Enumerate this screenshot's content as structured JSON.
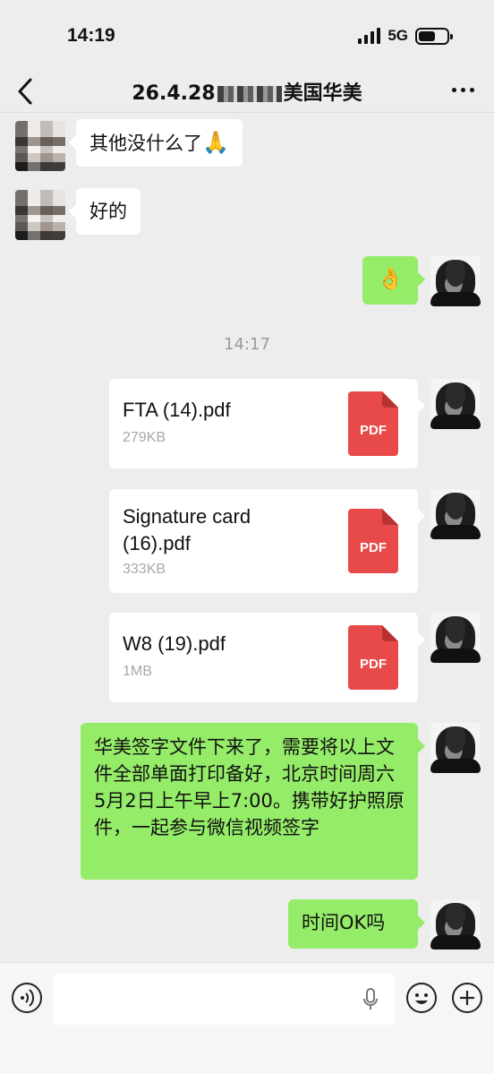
{
  "status_bar": {
    "time": "14:19",
    "network": "5G",
    "battery_level": 0.6
  },
  "header": {
    "title_prefix": "26.4.28",
    "title_suffix": "美国华美",
    "back_icon": "chevron-left-icon",
    "more_icon": "more-dots-icon"
  },
  "messages": [
    {
      "side": "left",
      "text": "其他没什么了",
      "emoji": "🙏"
    },
    {
      "side": "left",
      "text": "好的"
    },
    {
      "side": "right",
      "emoji": "👌"
    }
  ],
  "timestamp": "14:17",
  "files": [
    {
      "name": "FTA (14).pdf",
      "size": "279KB",
      "icon_label": "PDF"
    },
    {
      "name": "Signature card (16).pdf",
      "size": "333KB",
      "icon_label": "PDF"
    },
    {
      "name": "W8 (19).pdf",
      "size": "1MB",
      "icon_label": "PDF"
    }
  ],
  "long_message": "华美签字文件下来了，需要将以上文件全部单面打印备好，北京时间周六5月2日上午早上7:00。携带好护照原件，一起参与微信视频签字",
  "last_message": "时间OK吗",
  "colors": {
    "my_bubble": "#95ec69",
    "their_bubble": "#ffffff",
    "pdf_red": "#e84a4a",
    "background": "#ededed"
  },
  "input_bar": {
    "voice_icon": "voice-icon",
    "mic_icon": "mic-icon",
    "emoji_icon": "emoji-icon",
    "plus_icon": "plus-icon"
  }
}
